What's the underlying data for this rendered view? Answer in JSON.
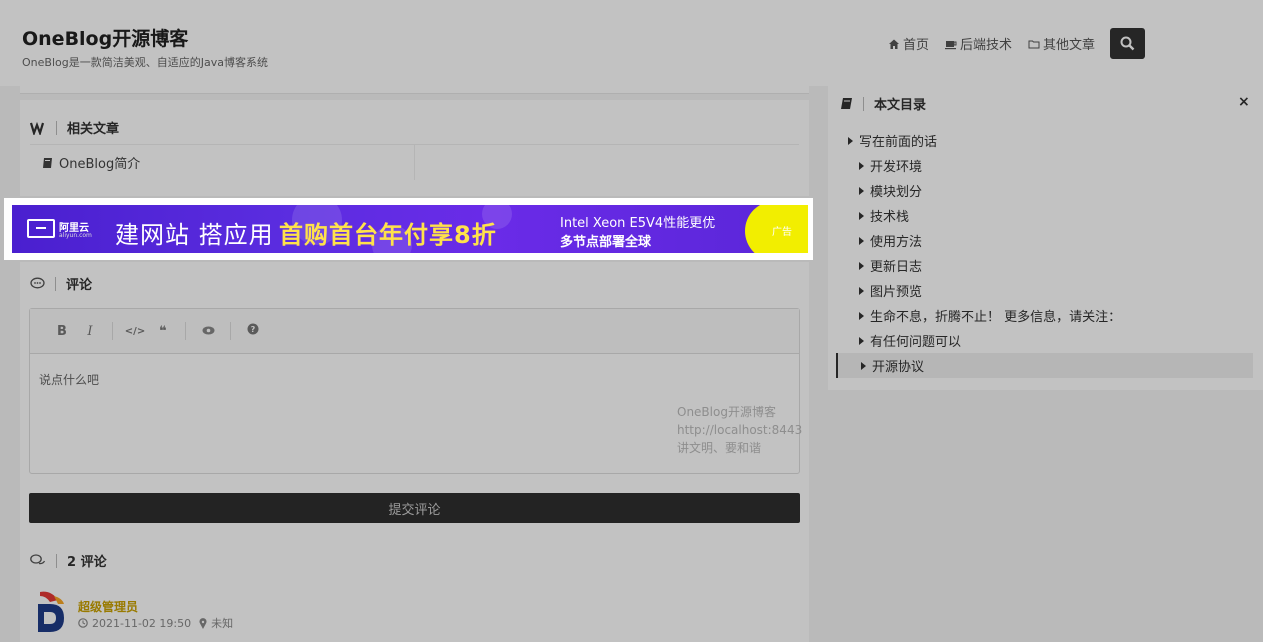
{
  "header": {
    "title": "OneBlog开源博客",
    "subtitle": "OneBlog是一款简洁美观、自适应的Java博客系统",
    "nav": [
      {
        "label": "首页",
        "icon": "home-icon"
      },
      {
        "label": "后端技术",
        "icon": "coffee-icon"
      },
      {
        "label": "其他文章",
        "icon": "folder-icon"
      }
    ],
    "search_icon": "search-icon"
  },
  "related": {
    "title": "相关文章",
    "items": [
      "OneBlog简介"
    ]
  },
  "ad": {
    "logo_cn": "阿里云",
    "logo_url": "aliyun.com",
    "headline_white": "建网站 搭应用",
    "headline_yellow": "首购首台年付享8折",
    "line1": "Intel Xeon E5V4性能更优",
    "line2": "多节点部署全球",
    "tag": "广告",
    "colors": {
      "background": "#5b2de0",
      "accent": "#ffe24a",
      "tag": "#f2ee00"
    }
  },
  "comment": {
    "title": "评论",
    "toolbar": [
      "B",
      "I",
      "</>",
      "❝",
      "👁",
      "?"
    ],
    "placeholder": "说点什么吧",
    "watermark": "OneBlog开源博客\nhttp://localhost:8443\n讲文明、要和谐",
    "submit": "提交评论",
    "count_title": "2 评论",
    "first": {
      "user": "超级管理员",
      "time": "2021-11-02 19:50",
      "location": "未知"
    }
  },
  "toc": {
    "title": "本文目录",
    "close": "×",
    "items": [
      {
        "label": "写在前面的话",
        "level": 1
      },
      {
        "label": "开发环境",
        "level": 2
      },
      {
        "label": "模块划分",
        "level": 2
      },
      {
        "label": "技术栈",
        "level": 2
      },
      {
        "label": "使用方法",
        "level": 2
      },
      {
        "label": "更新日志",
        "level": 2
      },
      {
        "label": "图片预览",
        "level": 2
      },
      {
        "label": "生命不息，折腾不止！ 更多信息，请关注：",
        "level": 2
      },
      {
        "label": "有任何问题可以",
        "level": 2
      },
      {
        "label": "开源协议",
        "level": 2,
        "active": true
      }
    ]
  }
}
